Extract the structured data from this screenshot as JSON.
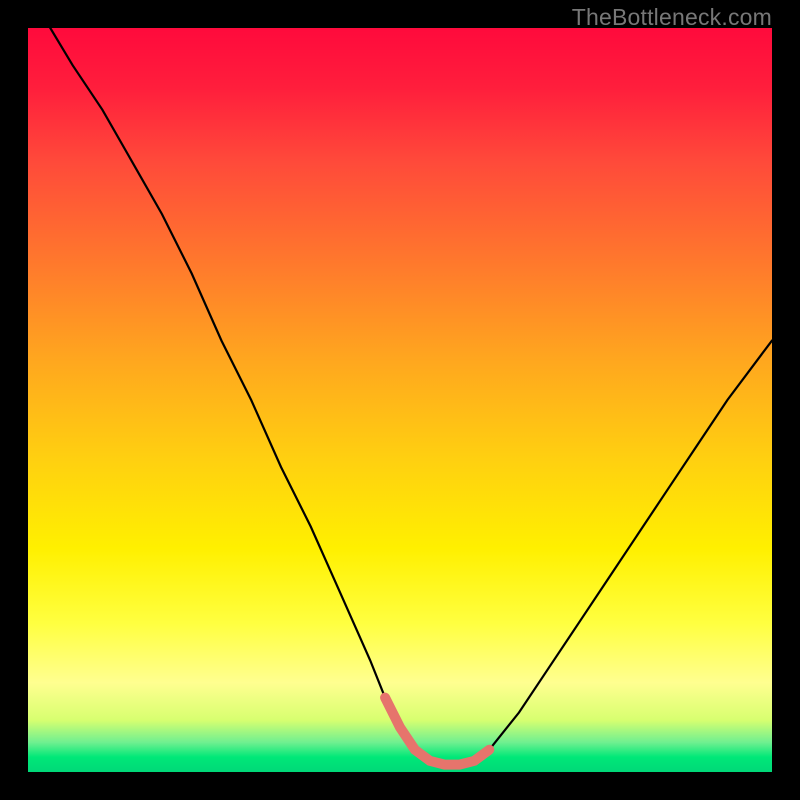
{
  "watermark": "TheBottleneck.com",
  "colors": {
    "curve_stroke": "#000000",
    "highlight_stroke": "#e6746c",
    "background_gradient_top": "#ff0a3c",
    "background_gradient_bottom": "#00d878",
    "frame_border": "#000000"
  },
  "chart_data": {
    "type": "line",
    "title": "",
    "xlabel": "",
    "ylabel": "",
    "xlim": [
      0,
      100
    ],
    "ylim": [
      0,
      100
    ],
    "x": [
      0,
      3,
      6,
      10,
      14,
      18,
      22,
      26,
      30,
      34,
      38,
      42,
      46,
      48,
      50,
      52,
      54,
      56,
      58,
      60,
      62,
      66,
      70,
      74,
      78,
      82,
      86,
      90,
      94,
      100
    ],
    "series": [
      {
        "name": "curve",
        "values": [
          104,
          100,
          95,
          89,
          82,
          75,
          67,
          58,
          50,
          41,
          33,
          24,
          15,
          10,
          6,
          3,
          1.5,
          1,
          1,
          1.5,
          3,
          8,
          14,
          20,
          26,
          32,
          38,
          44,
          50,
          58
        ]
      }
    ],
    "highlight": {
      "x_start": 48,
      "x_end": 62,
      "description": "flat bottom segment"
    },
    "grid": false,
    "legend": false
  }
}
